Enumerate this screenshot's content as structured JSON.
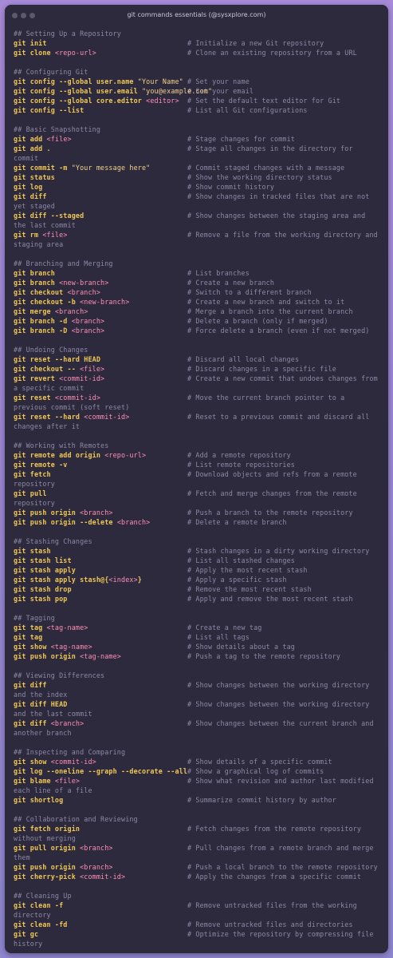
{
  "window": {
    "title": "git commands essentials (@sysxplore.com)",
    "colors": {
      "background": "#2d2a3e",
      "keyword": "#f0c755",
      "placeholder": "#ff8fb5",
      "comment": "#8d89a6",
      "text": "#e6e1f0"
    }
  },
  "sections": [
    {
      "heading": "## Setting Up a Repository",
      "rows": [
        {
          "cmd": [
            [
              "k",
              "git init"
            ]
          ],
          "comment": "# Initialize a new Git repository"
        },
        {
          "cmd": [
            [
              "k",
              "git clone "
            ],
            [
              "p",
              "<repo-url>"
            ]
          ],
          "comment": "# Clone an existing repository from a URL"
        }
      ]
    },
    {
      "heading": "## Configuring Git",
      "rows": [
        {
          "cmd": [
            [
              "k",
              "git config --global user.name "
            ],
            [
              "s",
              "\"Your Name\""
            ]
          ],
          "comment": "# Set your name"
        },
        {
          "cmd": [
            [
              "k",
              "git config --global user.email "
            ],
            [
              "s",
              "\"you@example.com\""
            ]
          ],
          "comment": "# Set your email"
        },
        {
          "cmd": [
            [
              "k",
              "git config --global core.editor "
            ],
            [
              "p",
              "<editor>"
            ]
          ],
          "comment": "# Set the default text editor for Git"
        },
        {
          "cmd": [
            [
              "k",
              "git config --list"
            ]
          ],
          "comment": "# List all Git configurations"
        }
      ]
    },
    {
      "heading": "## Basic Snapshotting",
      "rows": [
        {
          "cmd": [
            [
              "k",
              "git add "
            ],
            [
              "p",
              "<file>"
            ]
          ],
          "comment": "# Stage changes for commit"
        },
        {
          "cmd": [
            [
              "k",
              "git add ."
            ]
          ],
          "comment": "# Stage all changes in the directory for commit"
        },
        {
          "cmd": [
            [
              "k",
              "git commit -m "
            ],
            [
              "s",
              "\"Your message here\""
            ]
          ],
          "comment": "# Commit staged changes with a message"
        },
        {
          "cmd": [
            [
              "k",
              "git status"
            ]
          ],
          "comment": "# Show the working directory status"
        },
        {
          "cmd": [
            [
              "k",
              "git log"
            ]
          ],
          "comment": "# Show commit history"
        },
        {
          "cmd": [
            [
              "k",
              "git diff"
            ]
          ],
          "comment": "# Show changes in tracked files that are not yet staged"
        },
        {
          "cmd": [
            [
              "k",
              "git diff --staged"
            ]
          ],
          "comment": "# Show changes between the staging area and the last commit"
        },
        {
          "cmd": [
            [
              "k",
              "git rm "
            ],
            [
              "p",
              "<file>"
            ]
          ],
          "comment": "# Remove a file from the working directory and staging area"
        }
      ]
    },
    {
      "heading": "## Branching and Merging",
      "rows": [
        {
          "cmd": [
            [
              "k",
              "git branch"
            ]
          ],
          "comment": "# List branches"
        },
        {
          "cmd": [
            [
              "k",
              "git branch "
            ],
            [
              "p",
              "<new-branch>"
            ]
          ],
          "comment": "# Create a new branch"
        },
        {
          "cmd": [
            [
              "k",
              "git checkout "
            ],
            [
              "p",
              "<branch>"
            ]
          ],
          "comment": "# Switch to a different branch"
        },
        {
          "cmd": [
            [
              "k",
              "git checkout -b "
            ],
            [
              "p",
              "<new-branch>"
            ]
          ],
          "comment": "# Create a new branch and switch to it"
        },
        {
          "cmd": [
            [
              "k",
              "git merge "
            ],
            [
              "p",
              "<branch>"
            ]
          ],
          "comment": "# Merge a branch into the current branch"
        },
        {
          "cmd": [
            [
              "k",
              "git branch -d "
            ],
            [
              "p",
              "<branch>"
            ]
          ],
          "comment": "# Delete a branch (only if merged)"
        },
        {
          "cmd": [
            [
              "k",
              "git branch -D "
            ],
            [
              "p",
              "<branch>"
            ]
          ],
          "comment": "# Force delete a branch (even if not merged)"
        }
      ]
    },
    {
      "heading": "## Undoing Changes",
      "rows": [
        {
          "cmd": [
            [
              "k",
              "git reset --hard HEAD"
            ]
          ],
          "comment": "# Discard all local changes"
        },
        {
          "cmd": [
            [
              "k",
              "git checkout -- "
            ],
            [
              "p",
              "<file>"
            ]
          ],
          "comment": "# Discard changes in a specific file"
        },
        {
          "cmd": [
            [
              "k",
              "git revert "
            ],
            [
              "p",
              "<commit-id>"
            ]
          ],
          "comment": "# Create a new commit that undoes changes from a specific commit"
        },
        {
          "cmd": [
            [
              "k",
              "git reset "
            ],
            [
              "p",
              "<commit-id>"
            ]
          ],
          "comment": "# Move the current branch pointer to a previous commit (soft reset)"
        },
        {
          "cmd": [
            [
              "k",
              "git reset --hard "
            ],
            [
              "p",
              "<commit-id>"
            ]
          ],
          "comment": "# Reset to a previous commit and discard all changes after it"
        }
      ]
    },
    {
      "heading": "## Working with Remotes",
      "rows": [
        {
          "cmd": [
            [
              "k",
              "git remote add origin "
            ],
            [
              "p",
              "<repo-url>"
            ]
          ],
          "comment": "# Add a remote repository"
        },
        {
          "cmd": [
            [
              "k",
              "git remote -v"
            ]
          ],
          "comment": "# List remote repositories"
        },
        {
          "cmd": [
            [
              "k",
              "git fetch"
            ]
          ],
          "comment": "# Download objects and refs from a remote repository"
        },
        {
          "cmd": [
            [
              "k",
              "git pull"
            ]
          ],
          "comment": "# Fetch and merge changes from the remote repository"
        },
        {
          "cmd": [
            [
              "k",
              "git push origin "
            ],
            [
              "p",
              "<branch>"
            ]
          ],
          "comment": "# Push a branch to the remote repository"
        },
        {
          "cmd": [
            [
              "k",
              "git push origin --delete "
            ],
            [
              "p",
              "<branch>"
            ]
          ],
          "comment": "# Delete a remote branch"
        }
      ]
    },
    {
      "heading": "## Stashing Changes",
      "rows": [
        {
          "cmd": [
            [
              "k",
              "git stash"
            ]
          ],
          "comment": "# Stash changes in a dirty working directory"
        },
        {
          "cmd": [
            [
              "k",
              "git stash list"
            ]
          ],
          "comment": "# List all stashed changes"
        },
        {
          "cmd": [
            [
              "k",
              "git stash apply"
            ]
          ],
          "comment": "# Apply the most recent stash"
        },
        {
          "cmd": [
            [
              "k",
              "git stash apply stash@{"
            ],
            [
              "p",
              "<index>"
            ],
            [
              "k",
              "}"
            ]
          ],
          "comment": "# Apply a specific stash"
        },
        {
          "cmd": [
            [
              "k",
              "git stash drop"
            ]
          ],
          "comment": "# Remove the most recent stash"
        },
        {
          "cmd": [
            [
              "k",
              "git stash pop"
            ]
          ],
          "comment": "# Apply and remove the most recent stash"
        }
      ]
    },
    {
      "heading": "## Tagging",
      "rows": [
        {
          "cmd": [
            [
              "k",
              "git tag "
            ],
            [
              "p",
              "<tag-name>"
            ]
          ],
          "comment": "# Create a new tag"
        },
        {
          "cmd": [
            [
              "k",
              "git tag"
            ]
          ],
          "comment": "# List all tags"
        },
        {
          "cmd": [
            [
              "k",
              "git show "
            ],
            [
              "p",
              "<tag-name>"
            ]
          ],
          "comment": "# Show details about a tag"
        },
        {
          "cmd": [
            [
              "k",
              "git push origin "
            ],
            [
              "p",
              "<tag-name>"
            ]
          ],
          "comment": "# Push a tag to the remote repository"
        }
      ]
    },
    {
      "heading": "## Viewing Differences",
      "rows": [
        {
          "cmd": [
            [
              "k",
              "git diff"
            ]
          ],
          "comment": "# Show changes between the working directory and the index"
        },
        {
          "cmd": [
            [
              "k",
              "git diff HEAD"
            ]
          ],
          "comment": "# Show changes between the working directory and the last commit"
        },
        {
          "cmd": [
            [
              "k",
              "git diff "
            ],
            [
              "p",
              "<branch>"
            ]
          ],
          "comment": "# Show changes between the current branch and another branch"
        }
      ]
    },
    {
      "heading": "## Inspecting and Comparing",
      "rows": [
        {
          "cmd": [
            [
              "k",
              "git show "
            ],
            [
              "p",
              "<commit-id>"
            ]
          ],
          "comment": "# Show details of a specific commit"
        },
        {
          "cmd": [
            [
              "k",
              "git log --oneline --graph --decorate --all"
            ]
          ],
          "comment": "# Show a graphical log of commits"
        },
        {
          "cmd": [
            [
              "k",
              "git blame "
            ],
            [
              "p",
              "<file>"
            ]
          ],
          "comment": "# Show what revision and author last modified each line of a file"
        },
        {
          "cmd": [
            [
              "k",
              "git shortlog"
            ]
          ],
          "comment": "# Summarize commit history by author"
        }
      ]
    },
    {
      "heading": "## Collaboration and Reviewing",
      "rows": [
        {
          "cmd": [
            [
              "k",
              "git fetch origin"
            ]
          ],
          "comment": "# Fetch changes from the remote repository without merging"
        },
        {
          "cmd": [
            [
              "k",
              "git pull origin "
            ],
            [
              "p",
              "<branch>"
            ]
          ],
          "comment": "# Pull changes from a remote branch and merge them"
        },
        {
          "cmd": [
            [
              "k",
              "git push origin "
            ],
            [
              "p",
              "<branch>"
            ]
          ],
          "comment": "# Push a local branch to the remote repository"
        },
        {
          "cmd": [
            [
              "k",
              "git cherry-pick "
            ],
            [
              "p",
              "<commit-id>"
            ]
          ],
          "comment": "# Apply the changes from a specific commit"
        }
      ]
    },
    {
      "heading": "## Cleaning Up",
      "rows": [
        {
          "cmd": [
            [
              "k",
              "git clean -f"
            ]
          ],
          "comment": "# Remove untracked files from the working directory"
        },
        {
          "cmd": [
            [
              "k",
              "git clean -fd"
            ]
          ],
          "comment": "# Remove untracked files and directories"
        },
        {
          "cmd": [
            [
              "k",
              "git gc"
            ]
          ],
          "comment": "# Optimize the repository by compressing file history"
        }
      ]
    }
  ]
}
